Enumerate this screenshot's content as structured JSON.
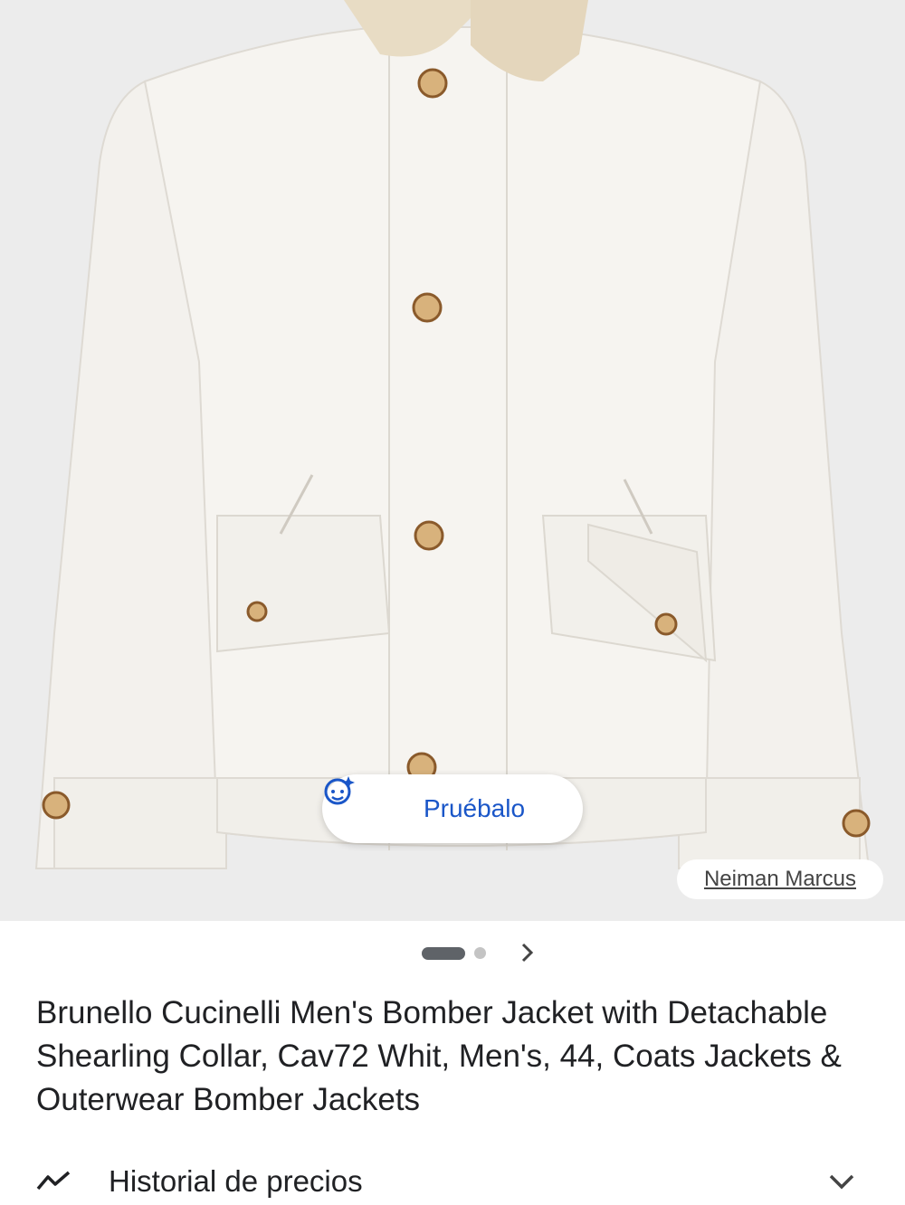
{
  "product": {
    "image_alt_icon": "jacket-photo",
    "try_on": {
      "label": "Pruébalo",
      "icon": "try-on-face-sparkle-icon"
    },
    "store": {
      "name": "Neiman Marcus"
    },
    "carousel": {
      "active_index": 1,
      "total": 2,
      "next_icon": "chevron-right-icon"
    },
    "title": "Brunello Cucinelli Men's Bomber Jacket with Detachable Shearling Collar, Cav72 Whit, Men's, 44, Coats Jackets & Outerwear Bomber Jackets"
  },
  "price_history": {
    "label": "Historial de precios",
    "icon": "trend-line-icon",
    "expand_icon": "chevron-down-icon"
  },
  "colors": {
    "accent": "#1a56c8",
    "text": "#202124",
    "hero_bg": "#ececec",
    "jacket": "#f4f2ee"
  }
}
